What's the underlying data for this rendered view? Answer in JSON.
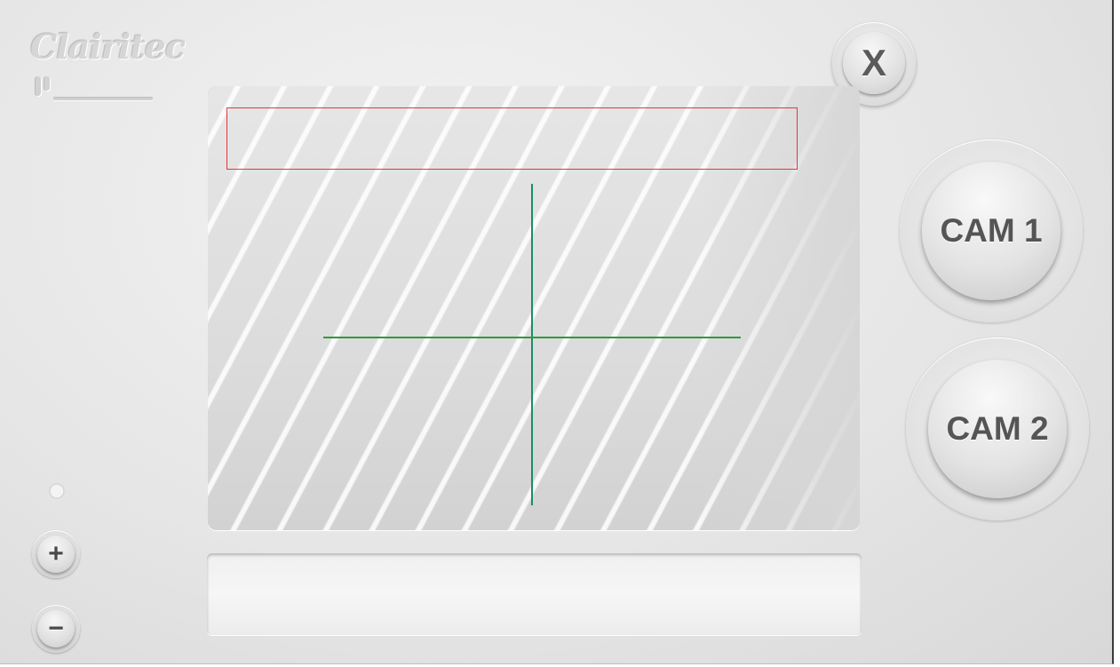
{
  "logo": {
    "text": "Clairitec"
  },
  "window": {
    "close_label": "X"
  },
  "camera_buttons": [
    {
      "label": "CAM 1"
    },
    {
      "label": "CAM 2"
    }
  ],
  "brightness": {
    "icon": "sun-icon",
    "increase_label": "+",
    "decrease_label": "−"
  },
  "camera_view": {
    "overlay_color": "#e0393b",
    "crosshair_vertical_color": "#1a8d66",
    "crosshair_horizontal_color": "#2f9a3a"
  },
  "status_bar": {
    "text": ""
  }
}
